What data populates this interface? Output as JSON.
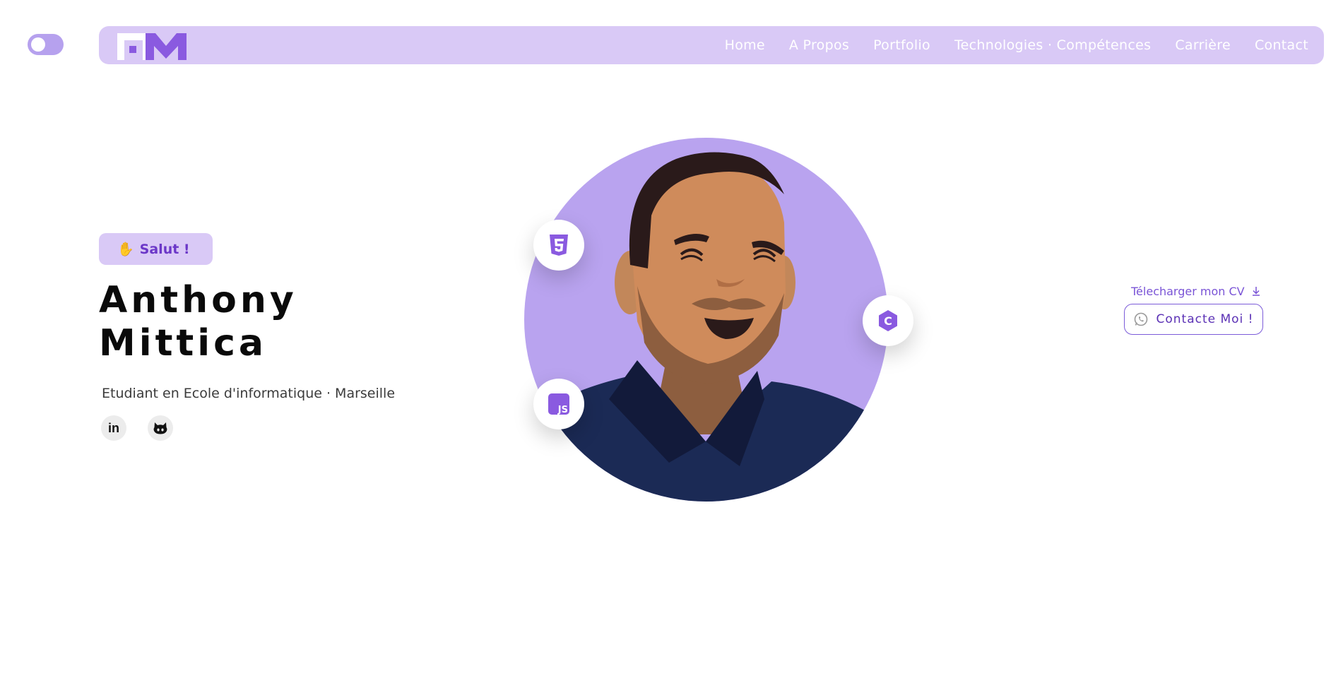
{
  "theme_toggle": {
    "state": "off"
  },
  "colors": {
    "accent": "#7b5bd9",
    "nav_bg": "#d9c9f6",
    "portrait_bg": "#b9a3ef",
    "shirt": "#1b2a55"
  },
  "nav": {
    "logo_icon": "am-logo",
    "links": [
      "Home",
      "A Propos",
      "Portfolio",
      "Technologies · Compétences",
      "Carrière",
      "Contact"
    ]
  },
  "hero": {
    "greeting_icon": "waving-hand-icon",
    "greeting": "Salut !",
    "name_line1": "Anthony",
    "name_line2": "Mittica",
    "subtitle": "Etudiant en Ecole d'informatique · Marseille",
    "socials": [
      {
        "icon": "linkedin-icon",
        "label": "in"
      },
      {
        "icon": "github-icon",
        "label": ""
      }
    ]
  },
  "portrait": {
    "badges": [
      {
        "icon": "html5-icon"
      },
      {
        "icon": "javascript-icon",
        "label": "JS"
      },
      {
        "icon": "c-language-icon",
        "label": "C"
      }
    ]
  },
  "actions": {
    "cv_label": "Télecharger mon CV",
    "cv_icon": "download-icon",
    "contact_label": "Contacte Moi !",
    "contact_icon": "whatsapp-icon"
  }
}
